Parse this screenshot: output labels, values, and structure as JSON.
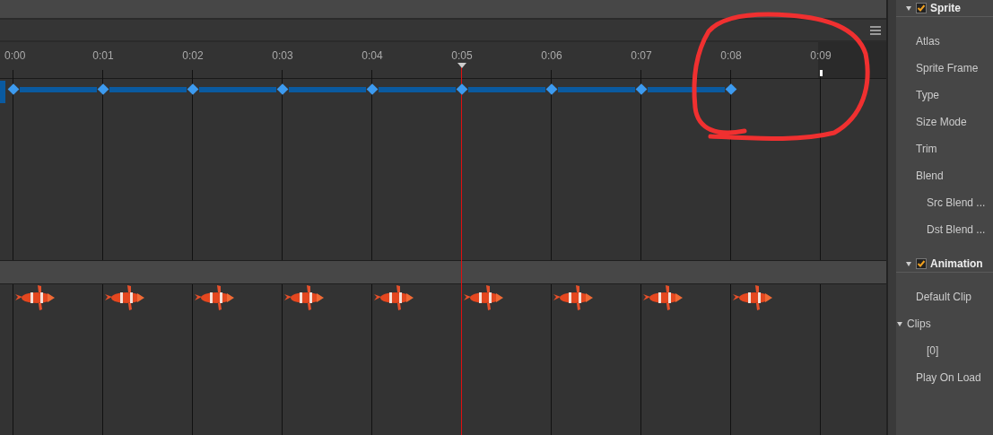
{
  "timeline": {
    "ticks": [
      {
        "label": "0:00",
        "selected": false,
        "keyframe": true,
        "frame": true
      },
      {
        "label": "0:01",
        "selected": false,
        "keyframe": true,
        "frame": true
      },
      {
        "label": "0:02",
        "selected": false,
        "keyframe": true,
        "frame": true
      },
      {
        "label": "0:03",
        "selected": false,
        "keyframe": true,
        "frame": true
      },
      {
        "label": "0:04",
        "selected": false,
        "keyframe": true,
        "frame": true
      },
      {
        "label": "0:05",
        "selected": true,
        "keyframe": true,
        "frame": true
      },
      {
        "label": "0:06",
        "selected": false,
        "keyframe": true,
        "frame": true
      },
      {
        "label": "0:07",
        "selected": false,
        "keyframe": true,
        "frame": true
      },
      {
        "label": "0:08",
        "selected": false,
        "keyframe": true,
        "frame": true
      },
      {
        "label": "0:09",
        "selected": false,
        "keyframe": false,
        "frame": false
      }
    ]
  },
  "inspector": {
    "sections": [
      {
        "title": "Sprite",
        "checked": true,
        "expanded": true,
        "properties": [
          {
            "label": "Atlas"
          },
          {
            "label": "Sprite Frame"
          },
          {
            "label": "Type"
          },
          {
            "label": "Size Mode"
          },
          {
            "label": "Trim"
          },
          {
            "label": "Blend",
            "children": [
              {
                "label": "Src Blend ..."
              },
              {
                "label": "Dst Blend ..."
              }
            ]
          }
        ]
      },
      {
        "title": "Animation",
        "checked": true,
        "expanded": true,
        "properties": [
          {
            "label": "Default Clip"
          },
          {
            "label": "Clips",
            "expanded": true,
            "children": [
              {
                "label": "[0]"
              }
            ]
          },
          {
            "label": "Play On Load"
          }
        ]
      }
    ]
  }
}
